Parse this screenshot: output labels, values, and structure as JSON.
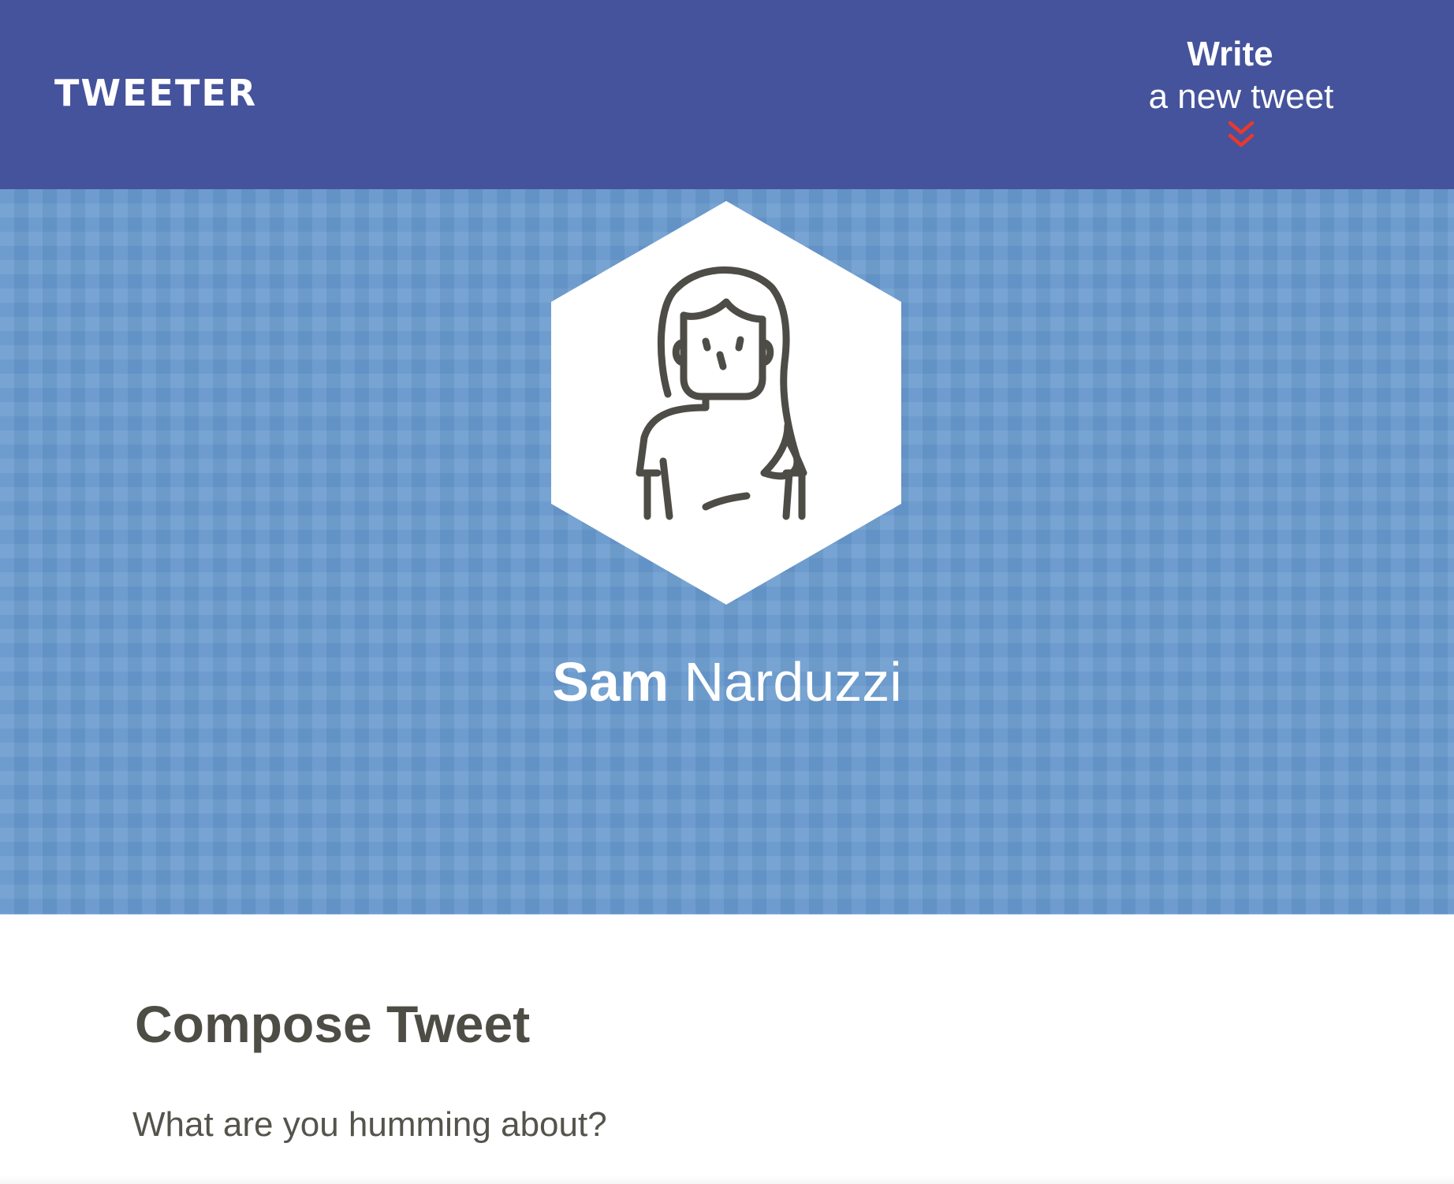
{
  "header": {
    "brand": "TWEETER",
    "write_title": "Write",
    "write_subtitle": "a new tweet",
    "toggle_icon": "double-chevron-down-icon",
    "background_color": "#45539c",
    "accent_color": "#e8392e"
  },
  "profile": {
    "first_name": "Sam",
    "last_name": "Narduzzi",
    "avatar_icon": "woman-avatar-icon",
    "hero_color": "#6a9bce"
  },
  "compose": {
    "title": "Compose Tweet",
    "placeholder": "What are you humming about?",
    "value": "",
    "text_color": "#4e4d45"
  }
}
